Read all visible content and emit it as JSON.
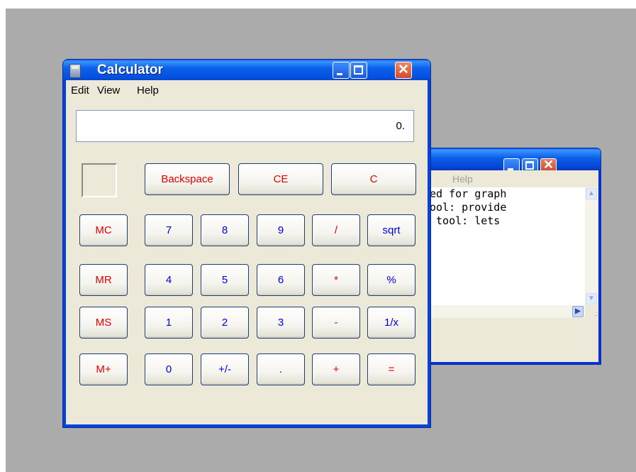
{
  "notepad": {
    "menu": {
      "help": "Help"
    },
    "text_lines": [
      "ed for graph",
      "ool: provide",
      " tool: lets"
    ],
    "scroll": {
      "up": "▲",
      "down": "▼",
      "right": "▶",
      "grip": ".:"
    }
  },
  "calculator": {
    "title": "Calculator",
    "window_controls": {
      "minimize": "_",
      "maximize": "□",
      "close": "✕"
    },
    "menu": {
      "edit": "Edit",
      "view": "View",
      "help": "Help"
    },
    "display": "0.",
    "buttons": {
      "backspace": "Backspace",
      "ce": "CE",
      "c": "C",
      "mc": "MC",
      "mr": "MR",
      "ms": "MS",
      "mplus": "M+",
      "seven": "7",
      "eight": "8",
      "nine": "9",
      "divide": "/",
      "sqrt": "sqrt",
      "four": "4",
      "five": "5",
      "six": "6",
      "multiply": "*",
      "percent": "%",
      "one": "1",
      "two": "2",
      "three": "3",
      "minus": "-",
      "reciprocal": "1/x",
      "zero": "0",
      "plusminus": "+/-",
      "dot": ".",
      "plus": "+",
      "equals": "="
    }
  },
  "colors": {
    "desktop": "#ababab",
    "titlebar_blue": "#0a5fe8",
    "window_face": "#ece9d8",
    "button_red_text": "#e00000",
    "button_blue_text": "#0000e0",
    "close_button": "#d24a2c"
  }
}
